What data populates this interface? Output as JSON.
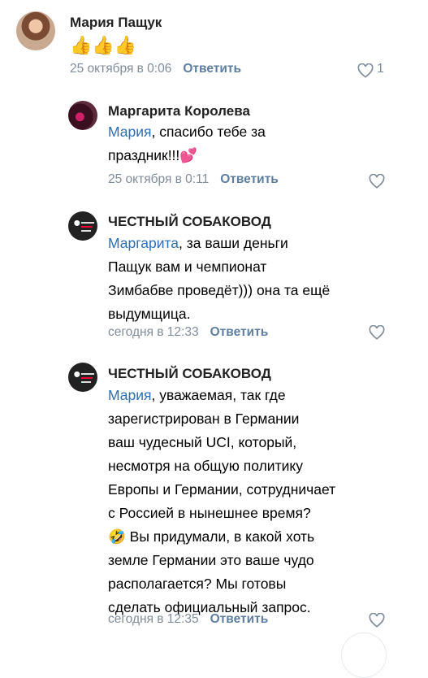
{
  "comments": [
    {
      "author": "Мария Пащук",
      "text": "👍👍👍",
      "date": "25 октября в 0:06",
      "reply": "Ответить",
      "likes": "1"
    },
    {
      "author": "Маргарита Королева",
      "mention": "Мария",
      "text_line1": ", спасибо тебе за",
      "text_line2": "праздник!!!💕",
      "date": "25 октября в 0:11",
      "reply": "Ответить"
    },
    {
      "author": "ЧЕСТНЫЙ СОБАКОВОД",
      "mention": "Маргарита",
      "text_line1": ", за ваши деньги",
      "text_line2": "Пащук вам и чемпионат",
      "text_line3": "Зимбабве проведёт))) она та ещё",
      "text_line4": "выдумщица.",
      "date": "сегодня в 12:33",
      "reply": "Ответить"
    },
    {
      "author": "ЧЕСТНЫЙ СОБАКОВОД",
      "mention": "Мария",
      "text_line1": ", уважаемая, так где",
      "text_line2": "зарегистрирован в Германии",
      "text_line3": "ваш чудесный UCI, который,",
      "text_line4": "несмотря на общую политику",
      "text_line5": "Европы и Германии, сотрудничает",
      "text_line6": "с Россией в нынешнее время?",
      "text_line7": "🤣 Вы придумали, в какой хоть",
      "text_line8": "земле Германии это ваше чудо",
      "text_line9": "располагается? Мы готовы",
      "text_line10": "сделать официальный запрос.",
      "date": "сегодня в 12:35",
      "reply": "Ответить"
    }
  ],
  "icons": {
    "like": "heart-outline-icon"
  },
  "colors": {
    "mention": "#2a6fb7",
    "meta": "#818c99",
    "reply": "#5e7ea1"
  }
}
